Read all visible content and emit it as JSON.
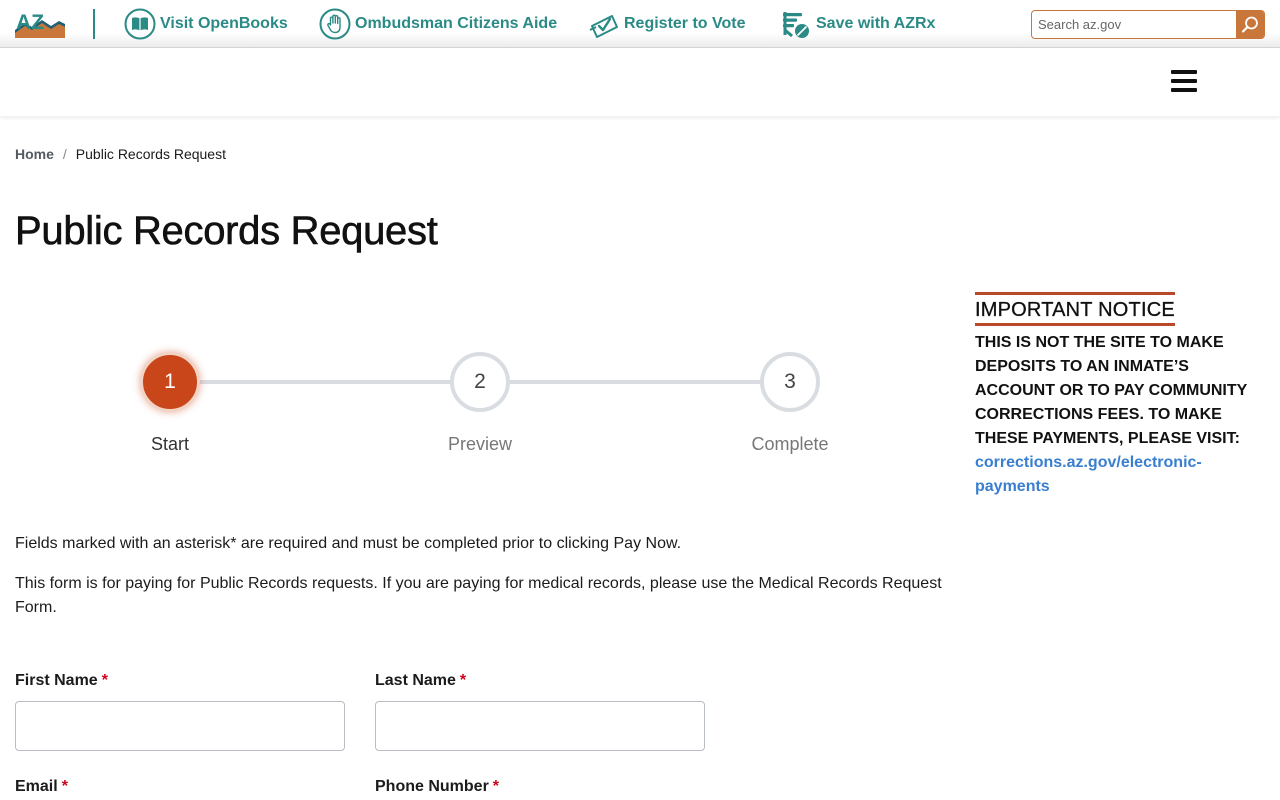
{
  "utility_bar": {
    "logo_text": "AZ",
    "links": [
      {
        "label": "Visit OpenBooks",
        "icon": "book-icon"
      },
      {
        "label": "Ombudsman Citizens Aide",
        "icon": "raised-hand-icon"
      },
      {
        "label": "Register to Vote",
        "icon": "ballot-check-icon"
      },
      {
        "label": "Save with AZRx",
        "icon": "prescription-pill-icon"
      }
    ],
    "search": {
      "placeholder": "Search az.gov",
      "value": "",
      "icon": "search-icon"
    }
  },
  "navbar": {
    "menu_icon": "hamburger-menu-icon"
  },
  "breadcrumb": {
    "home": "Home",
    "separator": "/",
    "current": "Public Records Request"
  },
  "page_title": "Public Records Request",
  "stepper": {
    "steps": [
      {
        "number": "1",
        "label": "Start",
        "state": "active"
      },
      {
        "number": "2",
        "label": "Preview",
        "state": "inactive"
      },
      {
        "number": "3",
        "label": "Complete",
        "state": "inactive"
      }
    ],
    "active_color": "#c9461b"
  },
  "instructions": {
    "required_note": "Fields marked with an asterisk* are required and must be completed prior to clicking Pay Now.",
    "form_note": "This form is for paying for Public Records requests. If you are paying for medical records, please use the Medical Records Request Form."
  },
  "form": {
    "required_marker": "*",
    "fields": [
      {
        "label": "First Name",
        "value": "",
        "required": true
      },
      {
        "label": "Last Name",
        "value": "",
        "required": true
      },
      {
        "label": "Email",
        "value": "",
        "required": true
      },
      {
        "label": "Phone Number",
        "value": "",
        "required": true
      }
    ]
  },
  "notice": {
    "title": "IMPORTANT NOTICE",
    "body": "THIS IS NOT THE SITE TO MAKE DEPOSITS TO AN INMATE’S ACCOUNT OR TO PAY COMMUNITY CORRECTIONS FEES. TO MAKE THESE PAYMENTS, PLEASE VISIT:",
    "link_text": "corrections.az.gov/electronic-payments"
  },
  "colors": {
    "teal": "#2a8a86",
    "orange": "#c8763a",
    "rust": "#b8482a",
    "link_blue": "#3a7fcf",
    "required_red": "#d0021b"
  }
}
